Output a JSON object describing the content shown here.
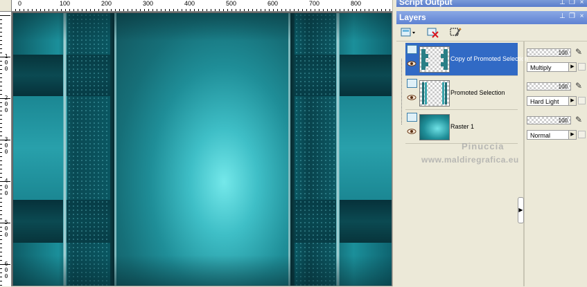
{
  "ruler": {
    "top_labels": [
      "0",
      "100",
      "200",
      "300",
      "400",
      "500",
      "600",
      "700",
      "800"
    ],
    "left_labels": [
      [
        "1",
        "0",
        "0"
      ],
      [
        "2",
        "0",
        "0"
      ],
      [
        "3",
        "0",
        "0"
      ],
      [
        "4",
        "0",
        "0"
      ],
      [
        "5",
        "0",
        "0"
      ],
      [
        "6",
        "0",
        "0"
      ]
    ]
  },
  "palettes": {
    "script_output_title": "Script Output",
    "layers_title": "Layers"
  },
  "toolbar": {
    "icons": [
      "new-layer-icon",
      "delete-layer-icon",
      "edit-selection-icon"
    ]
  },
  "layers": [
    {
      "name": "Copy of Promoted Selection",
      "opacity": "100",
      "blend_mode": "Multiply",
      "selected": true
    },
    {
      "name": "Promoted Selection",
      "opacity": "100",
      "blend_mode": "Hard Light",
      "selected": false
    },
    {
      "name": "Raster 1",
      "opacity": "100",
      "blend_mode": "Normal",
      "selected": false
    }
  ],
  "watermark": {
    "line1": "Pinuccia",
    "line2": "www.maldiregrafica.eu"
  },
  "colors": {
    "accent_selected": "#316ac5",
    "canvas_teal": "#1a8a95",
    "highlight_cyan": "#6ee6e8"
  }
}
